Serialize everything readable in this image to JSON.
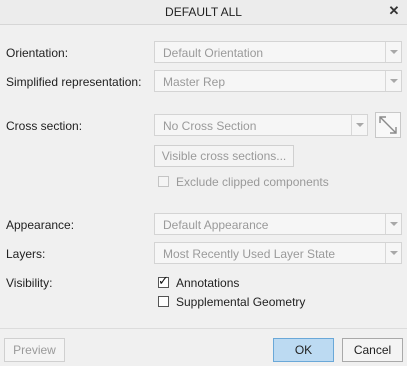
{
  "dialog": {
    "title": "DEFAULT ALL",
    "close_glyph": "✕"
  },
  "fields": {
    "orientation": {
      "label": "Orientation:",
      "value": "Default Orientation"
    },
    "simplified_rep": {
      "label": "Simplified representation:",
      "value": "Master Rep"
    },
    "cross_section": {
      "label": "Cross section:",
      "value": "No Cross Section",
      "visible_button": "Visible cross sections...",
      "exclude_clipped": {
        "label": "Exclude clipped components",
        "checked": false,
        "enabled": false
      }
    },
    "appearance": {
      "label": "Appearance:",
      "value": "Default Appearance"
    },
    "layers": {
      "label": "Layers:",
      "value": "Most Recently Used Layer State"
    },
    "visibility": {
      "label": "Visibility:",
      "annotations": {
        "label": "Annotations",
        "checked": true,
        "check_glyph": "✓"
      },
      "supplemental_geometry": {
        "label": "Supplemental Geometry",
        "checked": false
      }
    }
  },
  "footer": {
    "preview": "Preview",
    "ok": "OK",
    "cancel": "Cancel"
  },
  "colors": {
    "ok_fill": "#bcdaf2",
    "ok_border": "#6aa8d8",
    "disabled_text": "#9a9a9a"
  }
}
